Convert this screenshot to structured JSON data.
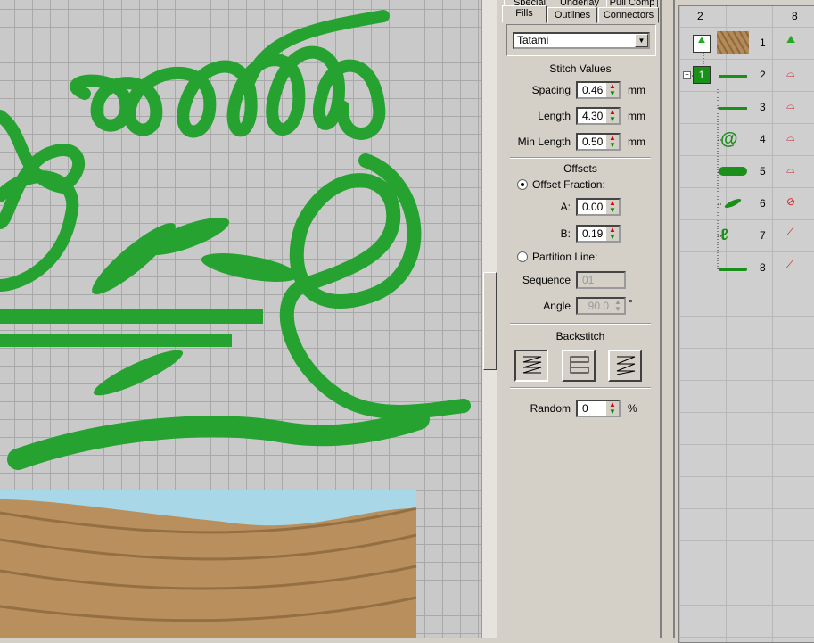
{
  "tabs_top": [
    "Special",
    "Underlay",
    "Pull Comp"
  ],
  "tabs": [
    "Fills",
    "Outlines",
    "Connectors"
  ],
  "fill_type": "Tatami",
  "stitch_values": {
    "title": "Stitch Values",
    "spacing_label": "Spacing",
    "spacing": "0.46",
    "length_label": "Length",
    "length": "4.30",
    "min_length_label": "Min Length",
    "min_length": "0.50",
    "unit": "mm"
  },
  "offsets": {
    "title": "Offsets",
    "offset_fraction": "Offset Fraction:",
    "a_label": "A:",
    "a": "0.00",
    "b_label": "B:",
    "b": "0.19",
    "partition_line": "Partition Line:",
    "sequence_label": "Sequence",
    "sequence": "01",
    "angle_label": "Angle",
    "angle": "90.0",
    "angle_unit": "°"
  },
  "backstitch": {
    "title": "Backstitch"
  },
  "random": {
    "label": "Random",
    "value": "0",
    "unit": "%"
  },
  "list": {
    "headers": [
      "2",
      "8"
    ],
    "group": "1",
    "rows": [
      "1",
      "2",
      "3",
      "4",
      "5",
      "6",
      "7",
      "8"
    ]
  },
  "colors": {
    "thread": "#1f9a2a",
    "canvas": "#c9c9c9"
  }
}
